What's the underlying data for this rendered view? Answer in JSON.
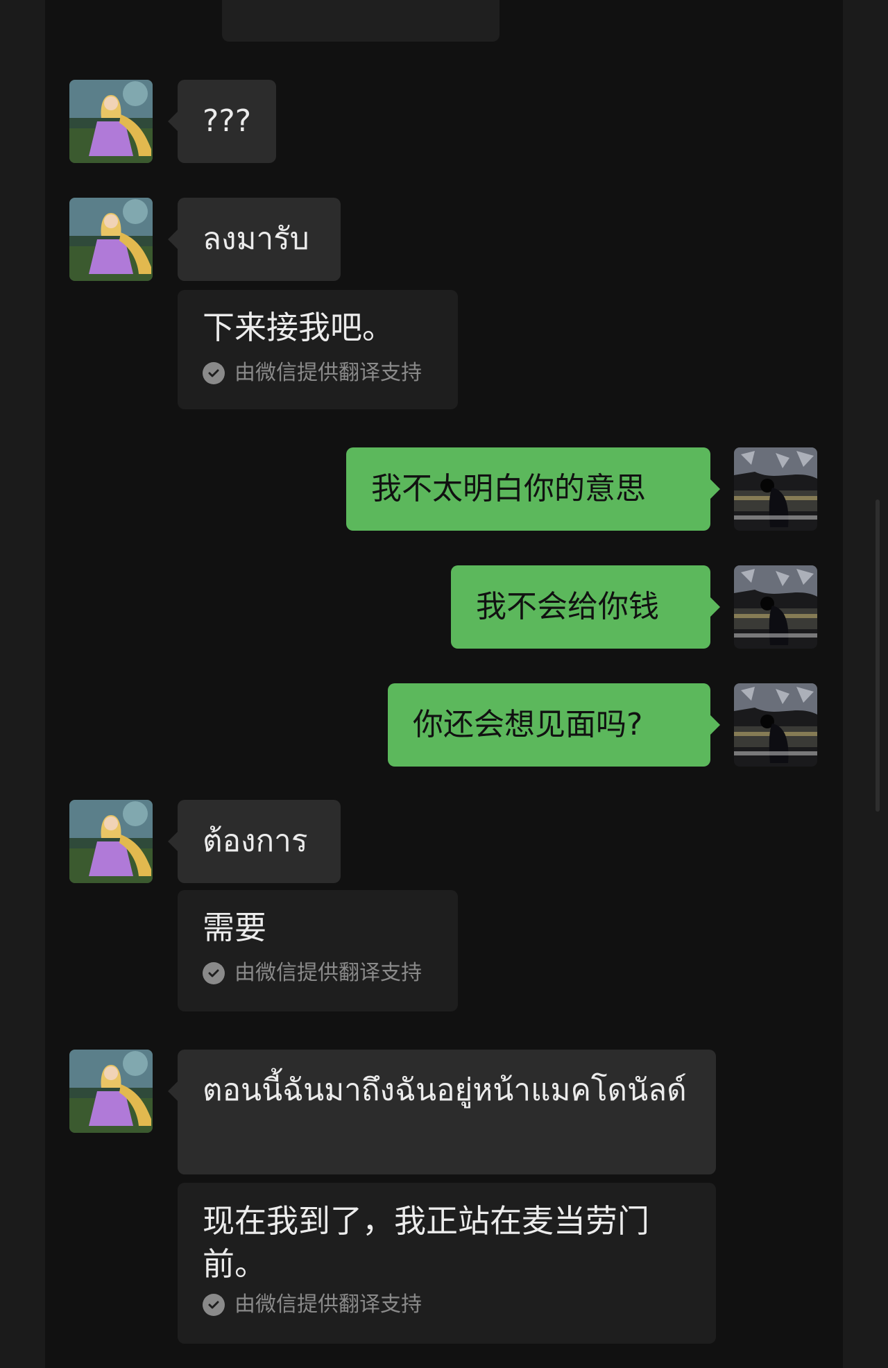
{
  "messages": [
    {
      "side": "in",
      "text": "???"
    },
    {
      "side": "in",
      "text": "ลงมารับ",
      "translation": "下来接我吧。"
    },
    {
      "side": "out",
      "text": "我不太明白你的意思"
    },
    {
      "side": "out",
      "text": "我不会给你钱"
    },
    {
      "side": "out",
      "text": "你还会想见面吗?"
    },
    {
      "side": "in",
      "text": "ต้องการ",
      "translation": "需要"
    },
    {
      "side": "in",
      "text": "ตอนนี้ฉันมาถึงฉันอยู่หน้าแมคโดนัลด์",
      "translation": "现在我到了，我正站在麦当劳门前。"
    }
  ],
  "translation_credit": "由微信提供翻译支持",
  "icons": {
    "contact_avatar": "princess-avatar-icon",
    "self_avatar": "night-scene-avatar-icon",
    "translation_check": "check-circle-icon"
  },
  "colors": {
    "outgoing_bubble": "#5cb85c",
    "incoming_bubble": "#2c2c2c",
    "translation_bubble": "#1e1e1e",
    "background": "#111111"
  }
}
